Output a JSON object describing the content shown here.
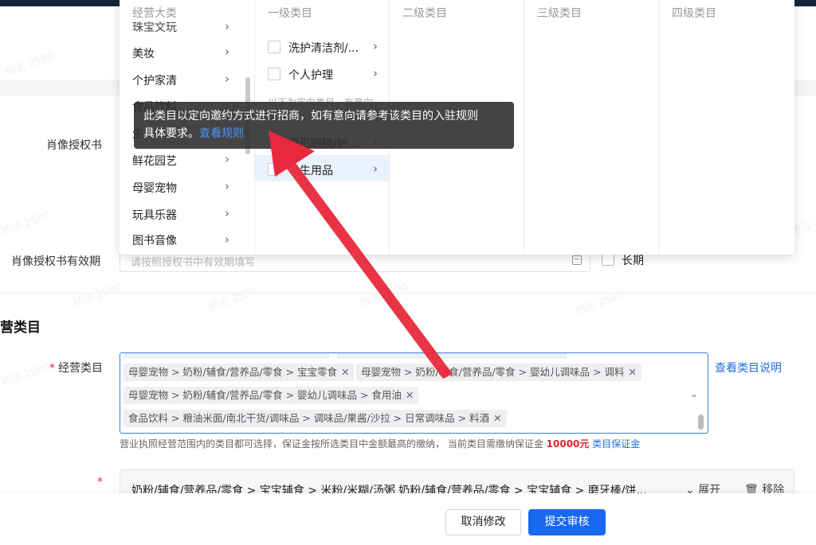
{
  "form": {
    "portrait_label": "肖像授权书",
    "validity_label": "肖像授权书有效期",
    "validity_placeholder": "请按照授权书中有效期填写",
    "long_term_label": "长期",
    "section_title": "营类目",
    "category_label": "经营类目",
    "view_desc_link": "查看类目说明",
    "hint_text": "营业执照经营范围内的类目都可选择，保证金按所选类目中金额最高的缴纳， 当前类目需缴纳保证金",
    "hint_amount": "10000元",
    "hint_link": "类目保证金",
    "selected_tags": [
      "母婴宠物 > 奶粉/辅食/营养品/零食 > 宝宝零食",
      "母婴宠物 > 奶粉/辅食/营养品/零食 > 婴幼儿调味品 > 调料",
      "母婴宠物 > 奶粉/辅食/营养品/零食 > 婴幼儿调味品 > 食用油",
      "食品饮料 > 粮油米面/南北干货/调味品 > 调味品/果酱/沙拉 > 日常调味品 > 料酒"
    ],
    "row_text": "奶粉/辅食/营养品/零食 > 宝宝辅食 > 米粉/米糊/汤粥    奶粉/辅食/营养品/零食 > 宝宝辅食 > 磨牙棒/饼...",
    "expand_label": "展开",
    "remove_label": "移除"
  },
  "cascader": {
    "headers": [
      "经营大类",
      "一级类目",
      "二级类目",
      "三级类目",
      "四级类目"
    ],
    "col1_partial_top": "珠宝文玩",
    "col1_items": [
      "美妆",
      "个护家清",
      "食品饮料",
      "生",
      "鲜花园艺",
      "母婴宠物",
      "玩具乐器",
      "图书音像"
    ],
    "col2_items": [
      "洗护清洁剂/...",
      "个人护理"
    ],
    "col2_hidden_text": "以下为定向类目，有意向",
    "col2_items_lower": [
      "隐形眼镜/护...",
      "生用品"
    ]
  },
  "tooltip": {
    "text_line1": "此类目以定向邀约方式进行招商，如有意向请参考该类目的入驻规则",
    "text_line2": "具体要求。",
    "link": "查看规则"
  },
  "footer": {
    "cancel_label": "取消修改",
    "submit_label": "提交审核"
  },
  "watermark": "杨洁 2580",
  "colors": {
    "accent": "#1868f0",
    "danger": "#e2262a",
    "tooltip_bg": "#303030",
    "annotation_arrow": "#e8283c"
  }
}
